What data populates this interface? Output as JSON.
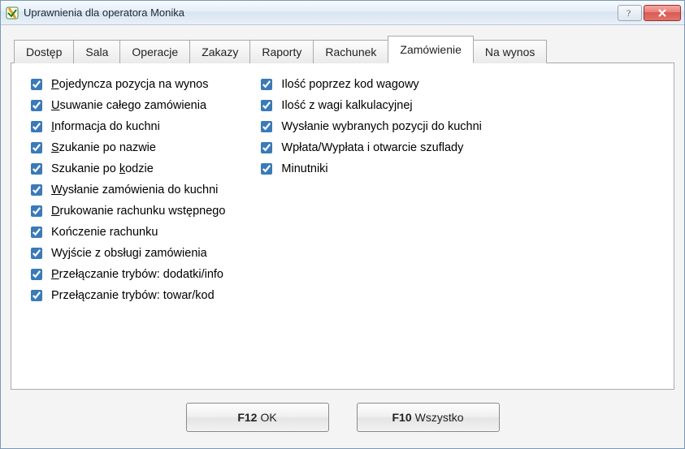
{
  "window": {
    "title": "Uprawnienia dla operatora Monika"
  },
  "tabs": [
    {
      "label": "Dostęp",
      "active": false
    },
    {
      "label": "Sala",
      "active": false
    },
    {
      "label": "Operacje",
      "active": false
    },
    {
      "label": "Zakazy",
      "active": false
    },
    {
      "label": "Raporty",
      "active": false
    },
    {
      "label": "Rachunek",
      "active": false
    },
    {
      "label": "Zamówienie",
      "active": true
    },
    {
      "label": "Na wynos",
      "active": false
    }
  ],
  "checkboxes": {
    "left": [
      {
        "label": "Pojedyncza pozycja na wynos",
        "underline": 0,
        "checked": true
      },
      {
        "label": "Usuwanie całego zamówienia",
        "underline": 0,
        "checked": true
      },
      {
        "label": "Informacja do kuchni",
        "underline": 0,
        "checked": true
      },
      {
        "label": "Szukanie po nazwie",
        "underline": 0,
        "checked": true
      },
      {
        "label": "Szukanie po kodzie",
        "underline": 12,
        "checked": true
      },
      {
        "label": "Wysłanie zamówienia do kuchni",
        "underline": 0,
        "checked": true
      },
      {
        "label": "Drukowanie rachunku wstępnego",
        "underline": 0,
        "checked": true
      },
      {
        "label": "Kończenie rachunku",
        "underline": -1,
        "checked": true
      },
      {
        "label": "Wyjście z obsługi zamówienia",
        "underline": -1,
        "checked": true
      },
      {
        "label": "Przełączanie trybów: dodatki/info",
        "underline": 0,
        "checked": true
      },
      {
        "label": "Przełączanie trybów: towar/kod",
        "underline": -1,
        "checked": true
      }
    ],
    "right": [
      {
        "label": "Ilość poprzez kod wagowy",
        "underline": -1,
        "checked": true
      },
      {
        "label": "Ilość z wagi kalkulacyjnej",
        "underline": -1,
        "checked": true
      },
      {
        "label": "Wysłanie wybranych pozycji do kuchni",
        "underline": -1,
        "checked": true
      },
      {
        "label": "Wpłata/Wypłata i otwarcie szuflady",
        "underline": -1,
        "checked": true
      },
      {
        "label": "Minutniki",
        "underline": -1,
        "checked": true
      }
    ]
  },
  "buttons": {
    "ok_key": "F12",
    "ok_label": "OK",
    "all_key": "F10",
    "all_label": "Wszystko"
  }
}
